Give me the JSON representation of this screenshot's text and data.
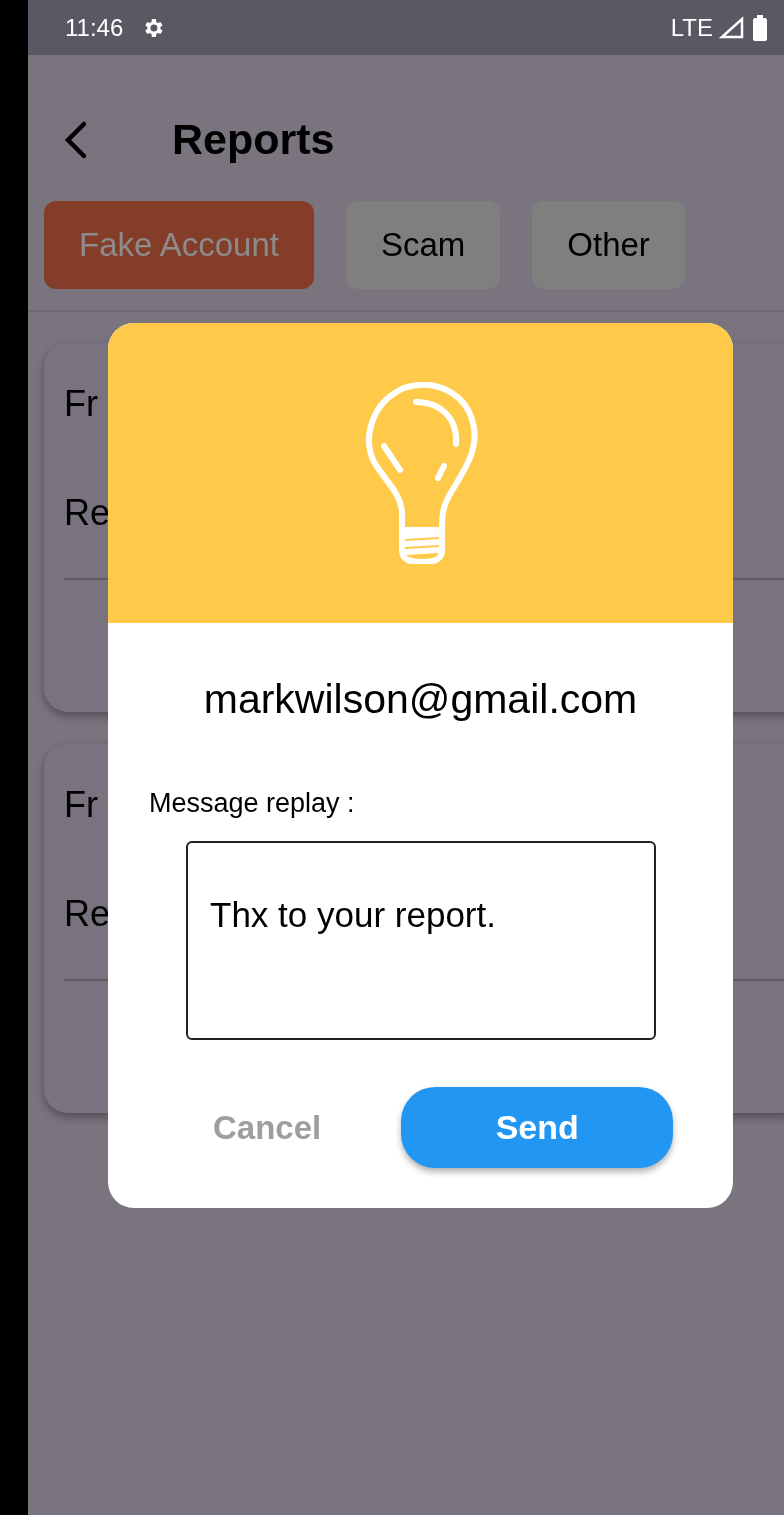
{
  "status_bar": {
    "time": "11:46",
    "network": "LTE"
  },
  "header": {
    "title": "Reports"
  },
  "tabs": [
    {
      "label": "Fake Account",
      "selected": true
    },
    {
      "label": "Scam",
      "selected": false
    },
    {
      "label": "Other",
      "selected": false
    }
  ],
  "cards": [
    {
      "line_1": "Fr",
      "line_2": "Re"
    },
    {
      "line_1": "Fr",
      "line_2": "Re"
    }
  ],
  "dialog": {
    "email": "markwilson@gmail.com",
    "field_label": "Message replay :",
    "message": "Thx to your report.",
    "cancel": "Cancel",
    "send": "Send"
  }
}
